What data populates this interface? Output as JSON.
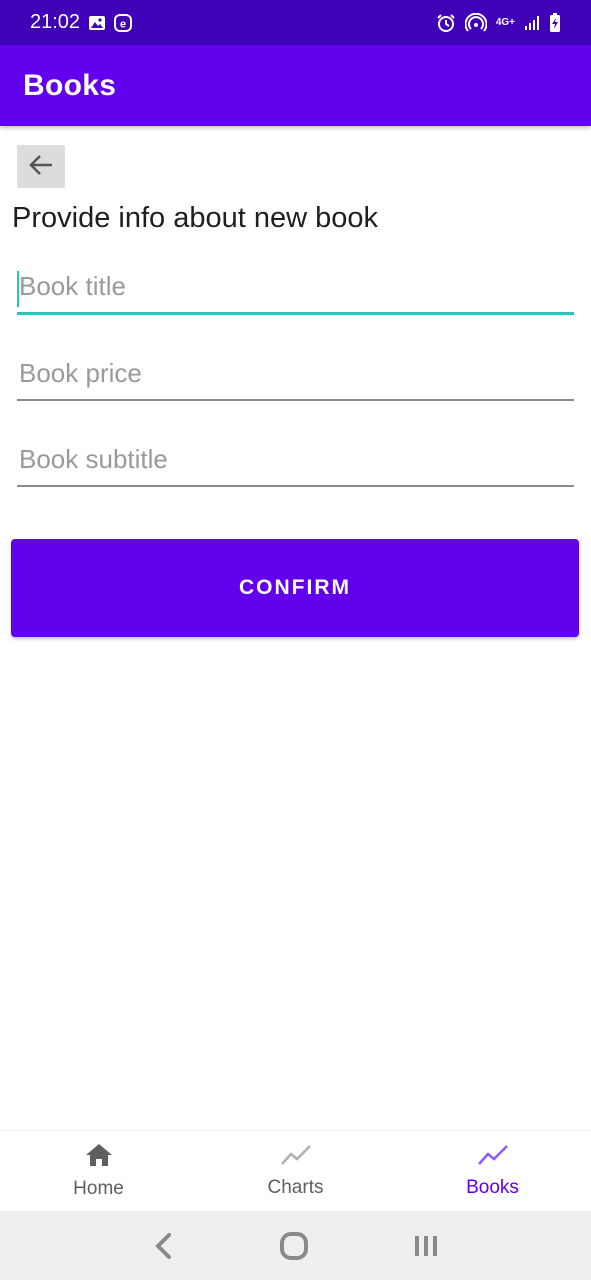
{
  "status_bar": {
    "time": "21:02",
    "network": "4G+",
    "icons": [
      "gallery-icon",
      "e-notification-icon",
      "alarm-icon",
      "hotspot-icon",
      "signal-icon",
      "battery-charging-icon"
    ]
  },
  "app_bar": {
    "title": "Books"
  },
  "form": {
    "heading": "Provide info about new book",
    "title_placeholder": "Book title",
    "price_placeholder": "Book price",
    "subtitle_placeholder": "Book subtitle",
    "confirm_label": "CONFIRM"
  },
  "bottom_nav": {
    "items": [
      {
        "label": "Home",
        "icon": "home-icon"
      },
      {
        "label": "Charts",
        "icon": "chart-line-icon"
      },
      {
        "label": "Books",
        "icon": "chart-line-icon",
        "active": true
      }
    ]
  },
  "colors": {
    "status_bar": "#3f02b7",
    "primary": "#6200ee",
    "focus_accent": "#26c6b9",
    "active_nav": "#6200ee"
  }
}
